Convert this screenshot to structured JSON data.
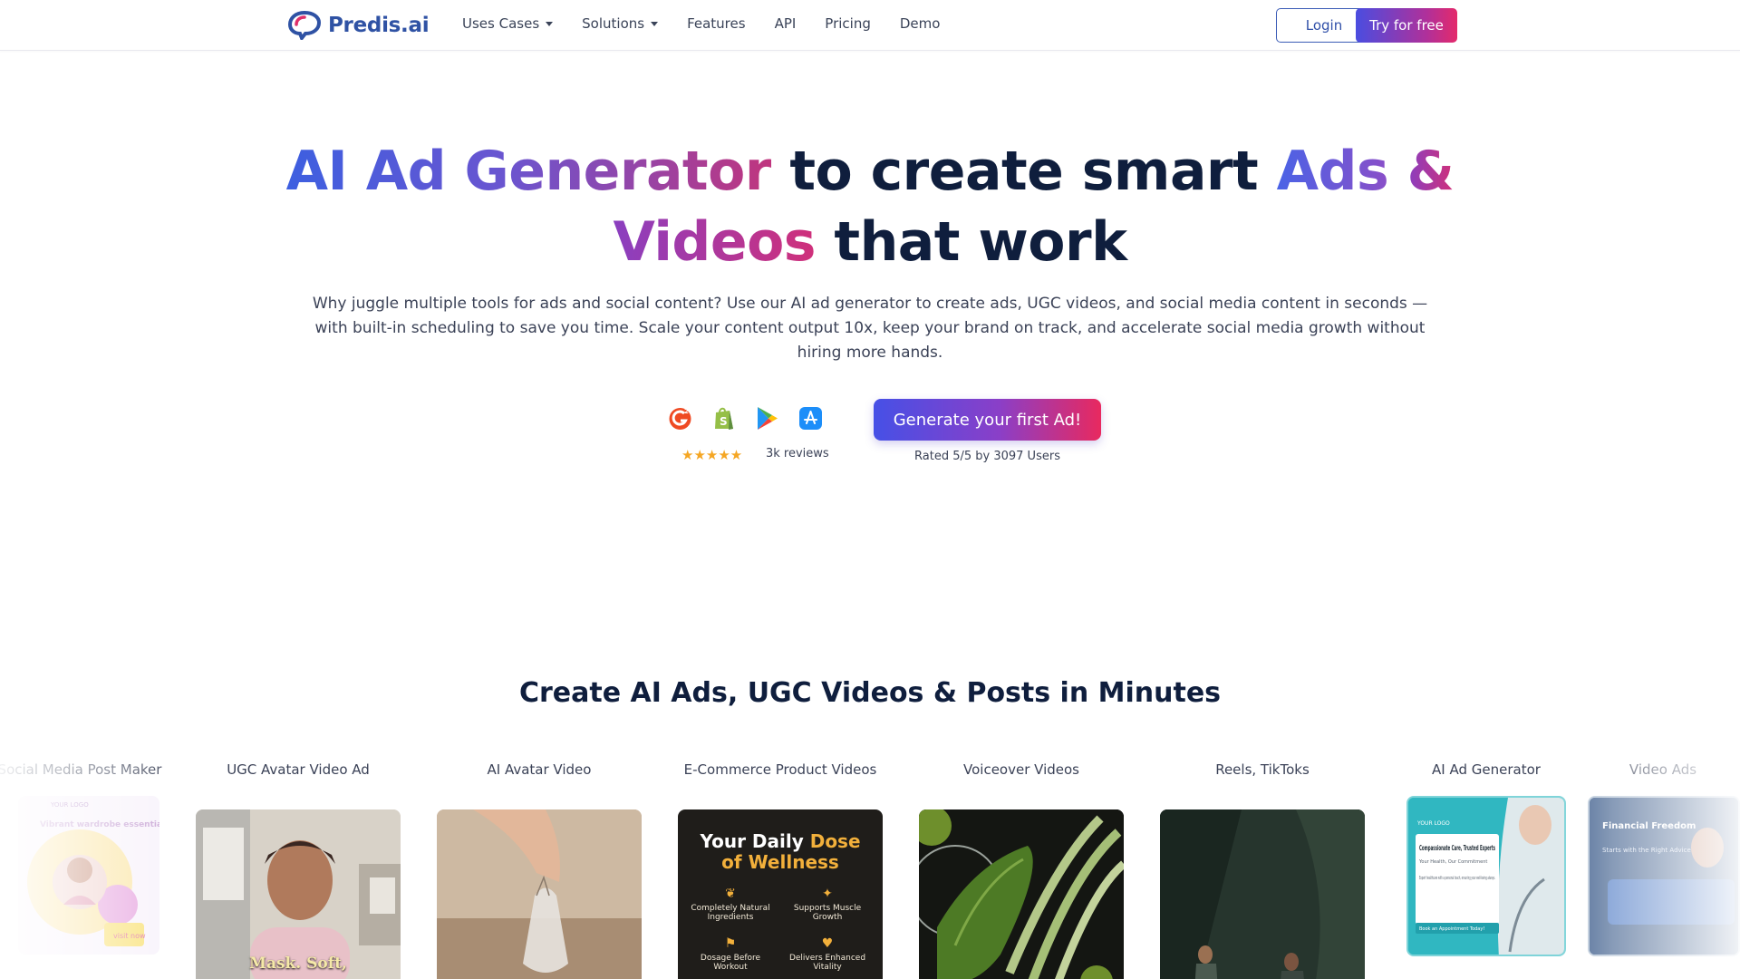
{
  "nav": {
    "logo_text": "Predis.ai",
    "links": [
      {
        "label": "Uses Cases",
        "dropdown": true
      },
      {
        "label": "Solutions",
        "dropdown": true
      },
      {
        "label": "Features",
        "dropdown": false
      },
      {
        "label": "API",
        "dropdown": false
      },
      {
        "label": "Pricing",
        "dropdown": false
      },
      {
        "label": "Demo",
        "dropdown": false
      }
    ],
    "login_label": "Login",
    "try_label": "Try for free"
  },
  "hero": {
    "title_part1": "AI Ad Generator",
    "title_part2": "to create smart",
    "title_part3": "Ads",
    "title_part4": "&",
    "title_part5": "Videos",
    "title_part6": "that work",
    "description": "Why juggle multiple tools for ads and social content? Use our AI ad generator to create ads, UGC videos, and social media content in seconds — with built-in scheduling to save you time. Scale your content output 10x, keep your brand on track, and accelerate social media growth without hiring more hands."
  },
  "reviews": {
    "platform_icons": [
      "g2-icon",
      "shopify-icon",
      "google-play-icon",
      "app-store-icon"
    ],
    "stars": "★★★★★",
    "count_text": "3k reviews",
    "cta_label": "Generate your first Ad!",
    "rated_text": "Rated 5/5 by 3097 Users"
  },
  "section": {
    "title": "Create AI Ads, UGC Videos & Posts in Minutes",
    "cards": [
      {
        "label": "Social Media Post Maker"
      },
      {
        "label": "UGC Avatar Video Ad",
        "caption": "Mask. Soft,"
      },
      {
        "label": "AI Avatar Video"
      },
      {
        "label": "E-Commerce Product Videos",
        "headline_1": "Your Daily",
        "headline_gold_1": "Dose",
        "headline_gold_2": "of Wellness",
        "features": [
          "Completely Natural Ingredients",
          "Supports Muscle Growth",
          "Dosage Before Workout",
          "Delivers Enhanced Vitality"
        ]
      },
      {
        "label": "Voiceover Videos"
      },
      {
        "label": "Reels, TikToks"
      },
      {
        "label": "AI Ad Generator",
        "logo_text": "YOUR LOGO",
        "headline": "Compassionate Care, Trusted Experts",
        "subline": "Your Health, Our Commitment",
        "body": "Expert healthcare with a personal touch, ensuring your well-being always.",
        "cta": "Book an Appointment Today!"
      },
      {
        "label": "Video Ads",
        "headline": "Financial Freedom",
        "subline": "Starts with the Right Advice"
      }
    ],
    "social_card": {
      "logo_text": "YOUR LOGO",
      "headline": "Vibrant wardrobe essentials here",
      "cta": "visit now"
    }
  },
  "colors": {
    "brand_blue": "#2f52a4",
    "accent_gradient_start": "#4650e6",
    "accent_gradient_end": "#e8295f",
    "star": "#f5a623"
  }
}
